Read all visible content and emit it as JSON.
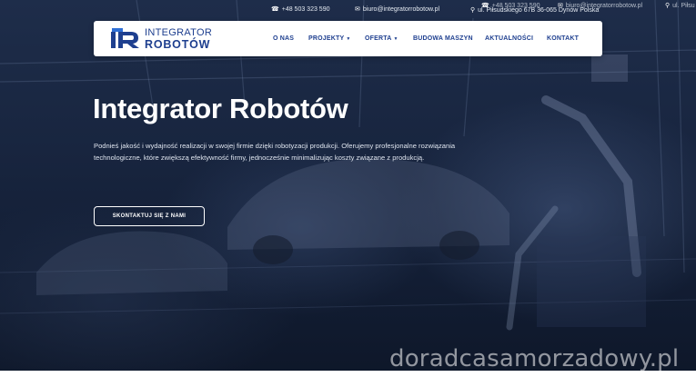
{
  "topbar": {
    "phone": "+48 503 323 590",
    "email": "biuro@integratorrobotow.pl",
    "address": "ul. Piłsudskiego 67B 36-065 Dynów Polska",
    "ghost_phone": "+48 503 323 590",
    "ghost_email": "biuro@integratorrobotow.pl",
    "ghost_address": "ul. Piłsu",
    "icons": [
      "phone-icon",
      "envelope-icon",
      "map-marker-icon"
    ]
  },
  "logo": {
    "line1": "INTEGRATOR",
    "line2": "ROBOTÓW",
    "mark": "IR"
  },
  "nav": {
    "items": [
      {
        "label": "O NAS",
        "has_dropdown": false
      },
      {
        "label": "PROJEKTY",
        "has_dropdown": true
      },
      {
        "label": "OFERTA",
        "has_dropdown": true
      },
      {
        "label": "BUDOWA MASZYN",
        "has_dropdown": false
      },
      {
        "label": "AKTUALNOŚCI",
        "has_dropdown": false
      },
      {
        "label": "KONTAKT",
        "has_dropdown": false
      }
    ],
    "chevron": "⌄"
  },
  "hero": {
    "title": "Integrator Robotów",
    "description": "Podnieś jakość i wydajność realizacji w swojej firmie dzięki robotyzacji produkcji. Oferujemy profesjonalne rozwiązania technologiczne, które zwiększą efektywność firmy, jednocześnie minimalizując koszty związane z produkcją.",
    "cta": "SKONTAKTUJ SIĘ Z NAMI"
  },
  "watermark": "doradcasamorzadowy.pl",
  "colors": {
    "brand": "#1e3f8f",
    "overlay": "#1a2742",
    "text": "#ffffff"
  }
}
